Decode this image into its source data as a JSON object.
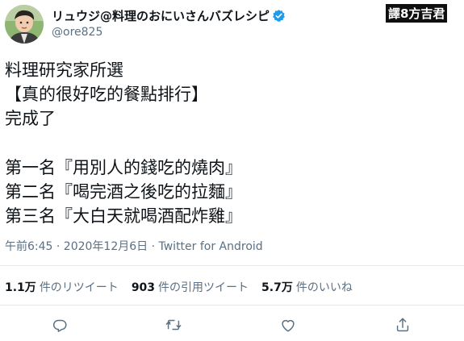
{
  "header": {
    "display_name": "リュウジ@料理のおにいさんバズレシピ",
    "handle": "@ore825",
    "verified_icon": "verified-badge-icon",
    "avatar_icon": "user-avatar"
  },
  "watermark": {
    "text": "譯8方吉君"
  },
  "tweet": {
    "lines": [
      "料理研究家所選",
      "【真的很好吃的餐點排行】",
      "完成了",
      "",
      "第一名『用別人的錢吃的燒肉』",
      "第二名『喝完酒之後吃的拉麵』",
      "第三名『大白天就喝酒配炸雞』"
    ]
  },
  "meta": {
    "timestamp": "午前6:45 · 2020年12月6日 · Twitter for Android"
  },
  "stats": {
    "retweets_count": "1.1万",
    "retweets_label": "件のリツイート",
    "quotes_count": "903",
    "quotes_label": "件の引用ツイート",
    "likes_count": "5.7万",
    "likes_label": "件のいいね"
  },
  "actions": {
    "reply_icon": "reply-icon",
    "retweet_icon": "retweet-icon",
    "like_icon": "like-icon",
    "share_icon": "share-icon"
  },
  "colors": {
    "text": "#0f1419",
    "secondary": "#5b7083",
    "divider": "#e3e8ec",
    "verified": "#1d9bf0"
  }
}
